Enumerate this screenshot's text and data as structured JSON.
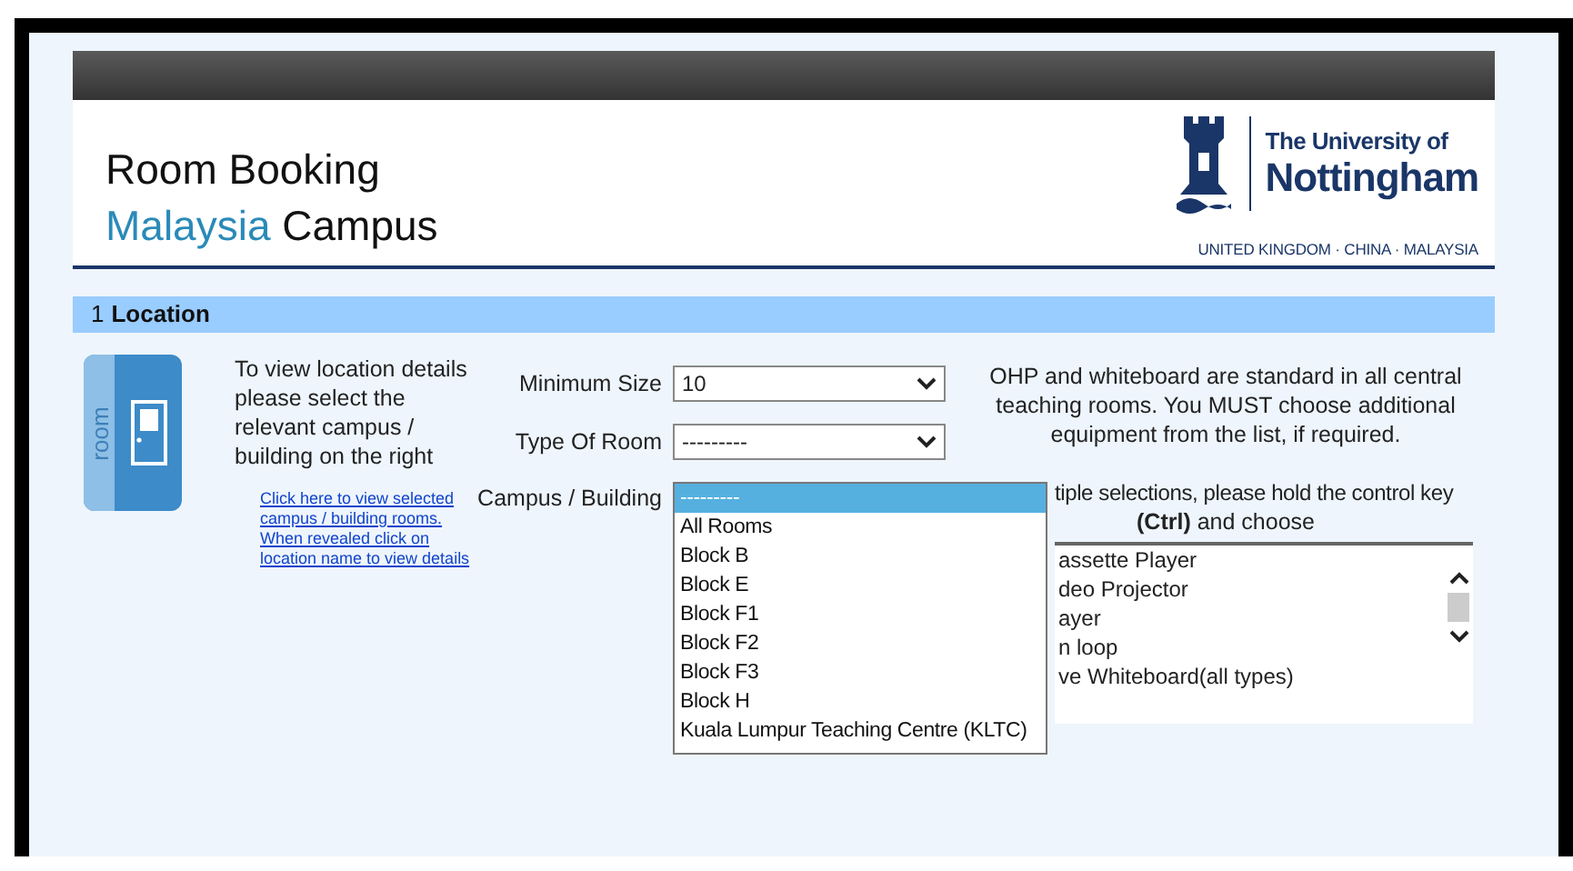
{
  "header": {
    "title": "Room Booking",
    "subtitle_accent": "Malaysia",
    "subtitle": "Campus",
    "logo_line1": "The University of",
    "logo_line2": "Nottingham",
    "logo_tagline": "UNITED KINGDOM · CHINA · MALAYSIA"
  },
  "section": {
    "number": "1",
    "title": "Location"
  },
  "location_icon_label": "room",
  "info": {
    "text": "To view location details please select the relevant campus / building on the right",
    "link": "Click here to view selected campus / building rooms. When revealed click on location name to view details"
  },
  "fields": [
    {
      "label": "Minimum Size",
      "value": "10"
    },
    {
      "label": "Type Of Room",
      "value": "---------"
    }
  ],
  "campus": {
    "label": "Campus / Building",
    "options": [
      {
        "label": "---------",
        "selected": true
      },
      {
        "label": "All Rooms",
        "selected": false
      },
      {
        "label": "Block B",
        "selected": false
      },
      {
        "label": "Block E",
        "selected": false
      },
      {
        "label": "Block F1",
        "selected": false
      },
      {
        "label": "Block F2",
        "selected": false
      },
      {
        "label": "Block F3",
        "selected": false
      },
      {
        "label": "Block H",
        "selected": false
      },
      {
        "label": "Kuala Lumpur Teaching Centre (KLTC)",
        "selected": false
      }
    ]
  },
  "equipment": {
    "note": "OHP and whiteboard are standard in all central teaching rooms. You MUST choose additional equipment from the list, if required.",
    "instruction_line1": "tiple selections, please hold the control key",
    "instruction_line2": "**(Ctrl)** and choose",
    "items": [
      "assette Player",
      "deo Projector",
      "ayer",
      "n loop",
      "ve Whiteboard(all types)"
    ]
  }
}
